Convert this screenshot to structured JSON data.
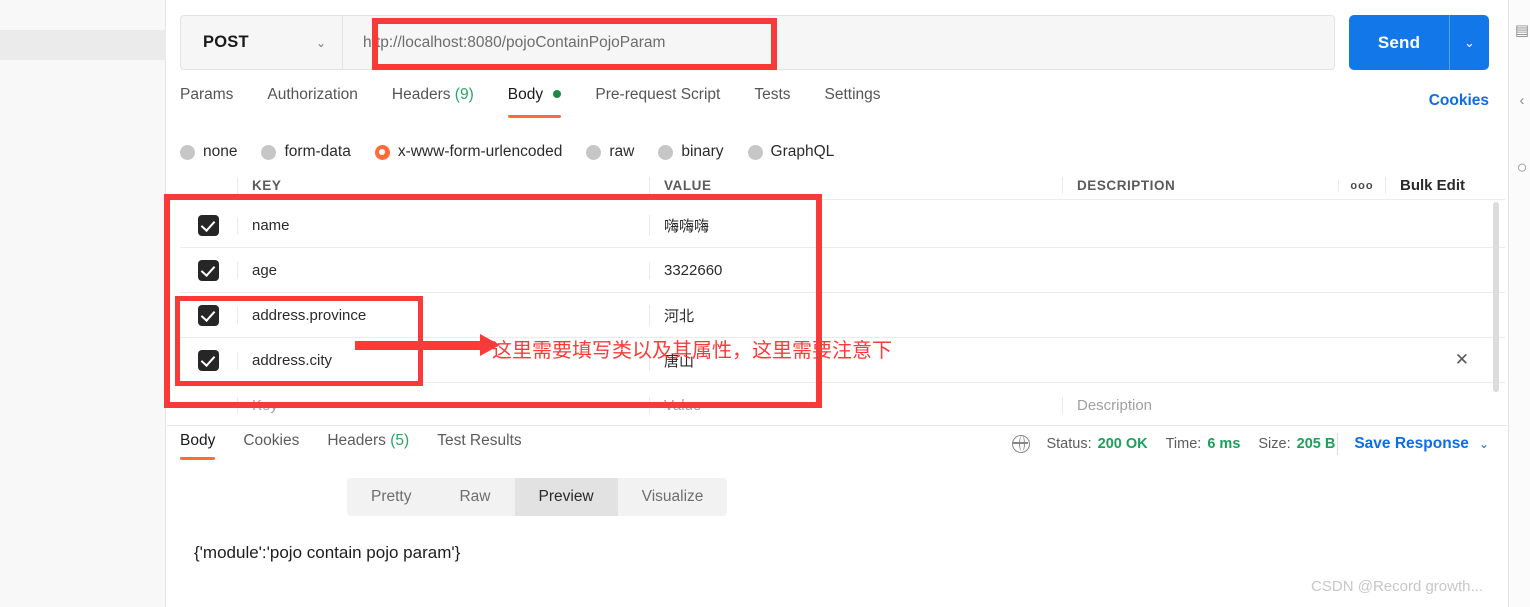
{
  "request": {
    "method": "POST",
    "method_caret": "⌄",
    "url": "http://localhost:8080/pojoContainPojoParam",
    "send_label": "Send",
    "send_caret": "⌄",
    "cookies_label": "Cookies"
  },
  "request_tabs": [
    {
      "label": "Params",
      "count": "",
      "active": false,
      "dot": false
    },
    {
      "label": "Authorization",
      "count": "",
      "active": false,
      "dot": false
    },
    {
      "label": "Headers",
      "count": "(9)",
      "active": false,
      "dot": false
    },
    {
      "label": "Body",
      "count": "",
      "active": true,
      "dot": true
    },
    {
      "label": "Pre-request Script",
      "count": "",
      "active": false,
      "dot": false
    },
    {
      "label": "Tests",
      "count": "",
      "active": false,
      "dot": false
    },
    {
      "label": "Settings",
      "count": "",
      "active": false,
      "dot": false
    }
  ],
  "body_types": [
    {
      "label": "none",
      "selected": false
    },
    {
      "label": "form-data",
      "selected": false
    },
    {
      "label": "x-www-form-urlencoded",
      "selected": true
    },
    {
      "label": "raw",
      "selected": false
    },
    {
      "label": "binary",
      "selected": false
    },
    {
      "label": "GraphQL",
      "selected": false
    }
  ],
  "kv_table": {
    "headers": {
      "key": "KEY",
      "value": "VALUE",
      "description": "DESCRIPTION",
      "more_icon": "ooo",
      "bulk_edit": "Bulk Edit"
    },
    "rows": [
      {
        "checked": true,
        "key": "name",
        "value": "嗨嗨嗨",
        "description": ""
      },
      {
        "checked": true,
        "key": "age",
        "value": "3322660",
        "description": ""
      },
      {
        "checked": true,
        "key": "address.province",
        "value": "河北",
        "description": ""
      },
      {
        "checked": true,
        "key": "address.city",
        "value": "唐山",
        "description": ""
      }
    ],
    "placeholder_row": {
      "key": "Key",
      "value": "Value",
      "description": "Description"
    },
    "remove_icon": "✕"
  },
  "response_tabs": [
    {
      "label": "Body",
      "count": "",
      "active": true
    },
    {
      "label": "Cookies",
      "count": "",
      "active": false
    },
    {
      "label": "Headers",
      "count": "(5)",
      "active": false
    },
    {
      "label": "Test Results",
      "count": "",
      "active": false
    }
  ],
  "response_meta": {
    "status_label": "Status:",
    "status_value": "200 OK",
    "time_label": "Time:",
    "time_value": "6 ms",
    "size_label": "Size:",
    "size_value": "205 B",
    "save_response": "Save Response",
    "save_caret": "⌄"
  },
  "view_modes": [
    {
      "label": "Pretty",
      "active": false
    },
    {
      "label": "Raw",
      "active": false
    },
    {
      "label": "Preview",
      "active": true
    },
    {
      "label": "Visualize",
      "active": false
    }
  ],
  "response_body": "{'module':'pojo contain pojo param'}",
  "annotation": {
    "text": "这里需要填写类以及其属性，这里需要注意下",
    "color": "#fb3b39"
  },
  "watermark": "CSDN @Record growth...",
  "right_rail_icons": [
    "document-icon",
    "chevron-left-icon",
    "circle-icon"
  ],
  "colors": {
    "accent_orange": "#ff6c37",
    "primary_blue": "#1277e8",
    "link_blue": "#0d6ce8",
    "success_green": "#19a15b",
    "annotation_red": "#fb3b39"
  }
}
